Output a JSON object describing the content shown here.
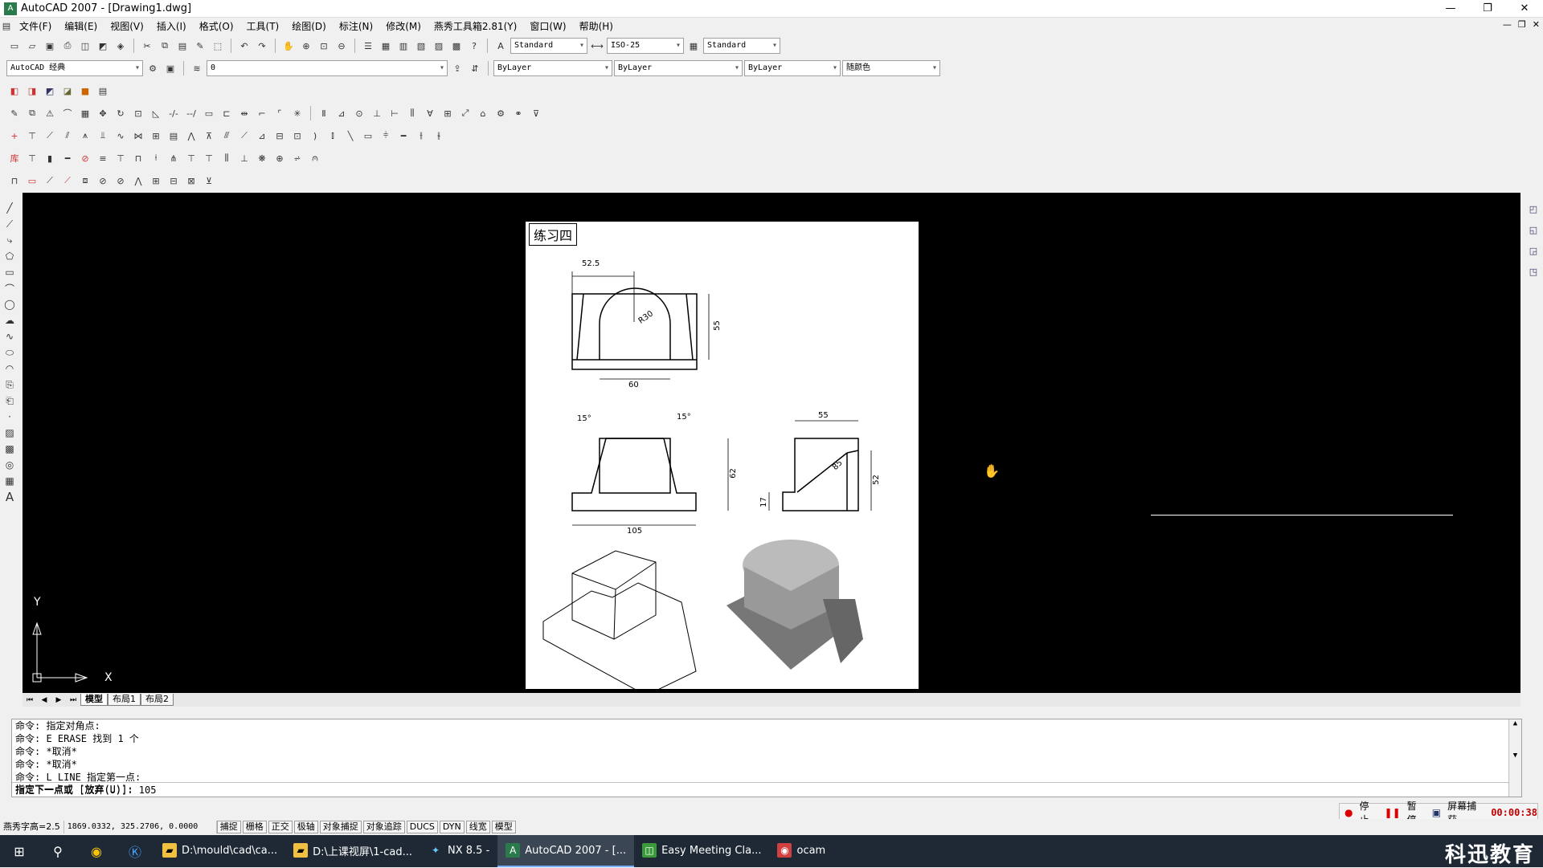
{
  "window": {
    "title": "AutoCAD 2007 - [Drawing1.dwg]",
    "controls": [
      "—",
      "❐",
      "✕"
    ]
  },
  "menu": {
    "items": [
      "文件(F)",
      "编辑(E)",
      "视图(V)",
      "插入(I)",
      "格式(O)",
      "工具(T)",
      "绘图(D)",
      "标注(N)",
      "修改(M)",
      "燕秀工具箱2.81(Y)",
      "窗口(W)",
      "帮助(H)"
    ],
    "doc_controls": [
      "—",
      "❐",
      "✕"
    ]
  },
  "toolbar": {
    "text_style": "Standard",
    "dim_style": "ISO-25",
    "table_style": "Standard",
    "workspace": "AutoCAD 经典",
    "layer": "0",
    "color": "ByLayer",
    "linetype": "ByLayer",
    "lineweight": "ByLayer",
    "plotstyle": "随颜色"
  },
  "sheet": {
    "title": "练习四",
    "dims": {
      "top_width": "52.5",
      "radius": "R30",
      "height": "55",
      "bottom_width": "60",
      "angle_left": "15°",
      "angle_right": "15°",
      "front_height": "62",
      "front_width": "105",
      "side_width": "55",
      "side_slant": "85",
      "side_height": "52",
      "side_low": "17"
    }
  },
  "ucs": {
    "x_label": "X",
    "y_label": "Y"
  },
  "layout_tabs": [
    "模型",
    "布局1",
    "布局2"
  ],
  "command": {
    "lines": [
      "命令: 指定对角点:",
      "命令: E ERASE 找到 1 个",
      "命令: *取消*",
      "命令: *取消*",
      "命令: L LINE 指定第一点:",
      "指定下一点或 [放弃(U)]: 105"
    ],
    "prompt": "指定下一点或 [放弃(U)]:"
  },
  "status": {
    "text_height": "燕秀字高=2.5",
    "coords": "1869.0332, 325.2706, 0.0000",
    "buttons": [
      "捕捉",
      "栅格",
      "正交",
      "极轴",
      "对象捕捉",
      "对象追踪",
      "DUCS",
      "DYN",
      "线宽",
      "模型"
    ]
  },
  "ocam": {
    "stop": "停止",
    "pause": "暂停",
    "capture": "屏幕捕获",
    "timer": "00:00:38"
  },
  "taskbar": {
    "tasks": [
      {
        "label": "D:\\mould\\cad\\ca...",
        "icon": "folder-icon",
        "active": false
      },
      {
        "label": "D:\\上课视屏\\1-cad...",
        "icon": "folder-icon",
        "active": false
      },
      {
        "label": "NX 8.5 -",
        "icon": "nx-icon",
        "active": false
      },
      {
        "label": "AutoCAD 2007 - [...",
        "icon": "autocad-icon",
        "active": true
      },
      {
        "label": "Easy Meeting Cla...",
        "icon": "meeting-icon",
        "active": false
      },
      {
        "label": "ocam",
        "icon": "ocam-icon",
        "active": false
      }
    ],
    "brand": "科迅教育"
  }
}
